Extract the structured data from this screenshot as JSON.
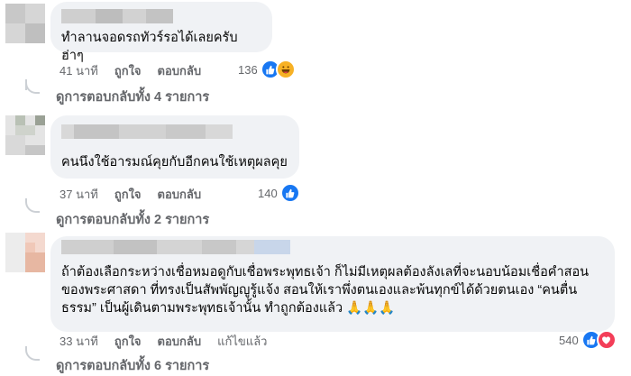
{
  "comments": [
    {
      "text": "ทำลานจอดรถทัวร์รอได้เลยครับ ฮ่าๆ",
      "time": "41 นาที",
      "like_label": "ถูกใจ",
      "reply_label": "ตอบกลับ",
      "reaction_count": "136",
      "reactions": [
        "like-icon",
        "haha-icon"
      ],
      "view_replies": "ดูการตอบกลับทั้ง 4 รายการ"
    },
    {
      "text": "คนนึงใช้อารมณ์คุยกับอีกคนใช้เหตุผลคุย",
      "time": "37 นาที",
      "like_label": "ถูกใจ",
      "reply_label": "ตอบกลับ",
      "reaction_count": "140",
      "reactions": [
        "like-icon"
      ],
      "view_replies": "ดูการตอบกลับทั้ง 2 รายการ"
    },
    {
      "text": "ถ้าต้องเลือกระหว่างเชื่อหมอดูกับเชื่อพระพุทธเจ้า ก็ไม่มีเหตุผลต้องลังเลที่จะนอบน้อมเชื่อคำสอนของพระศาสดา ที่ทรงเป็นสัพพัญญูรู้แจ้ง สอนให้เราพึ่งตนเองและพ้นทุกข์ได้ด้วยตนเอง “คนตื่นธรรม” เป็นผู้เดินตามพระพุทธเจ้านั้น ทำถูกต้องแล้ว 🙏🙏🙏",
      "time": "33 นาที",
      "like_label": "ถูกใจ",
      "reply_label": "ตอบกลับ",
      "edited_label": "แก้ไขแล้ว",
      "reaction_count": "540",
      "reactions": [
        "like-icon",
        "love-icon"
      ],
      "view_replies": "ดูการตอบกลับทั้ง 6 รายการ"
    }
  ],
  "colors": {
    "bubble": "#f0f2f5",
    "meta": "#65676b",
    "like": "#1877f2",
    "haha": "#f7b125",
    "love": "#f33e58"
  }
}
